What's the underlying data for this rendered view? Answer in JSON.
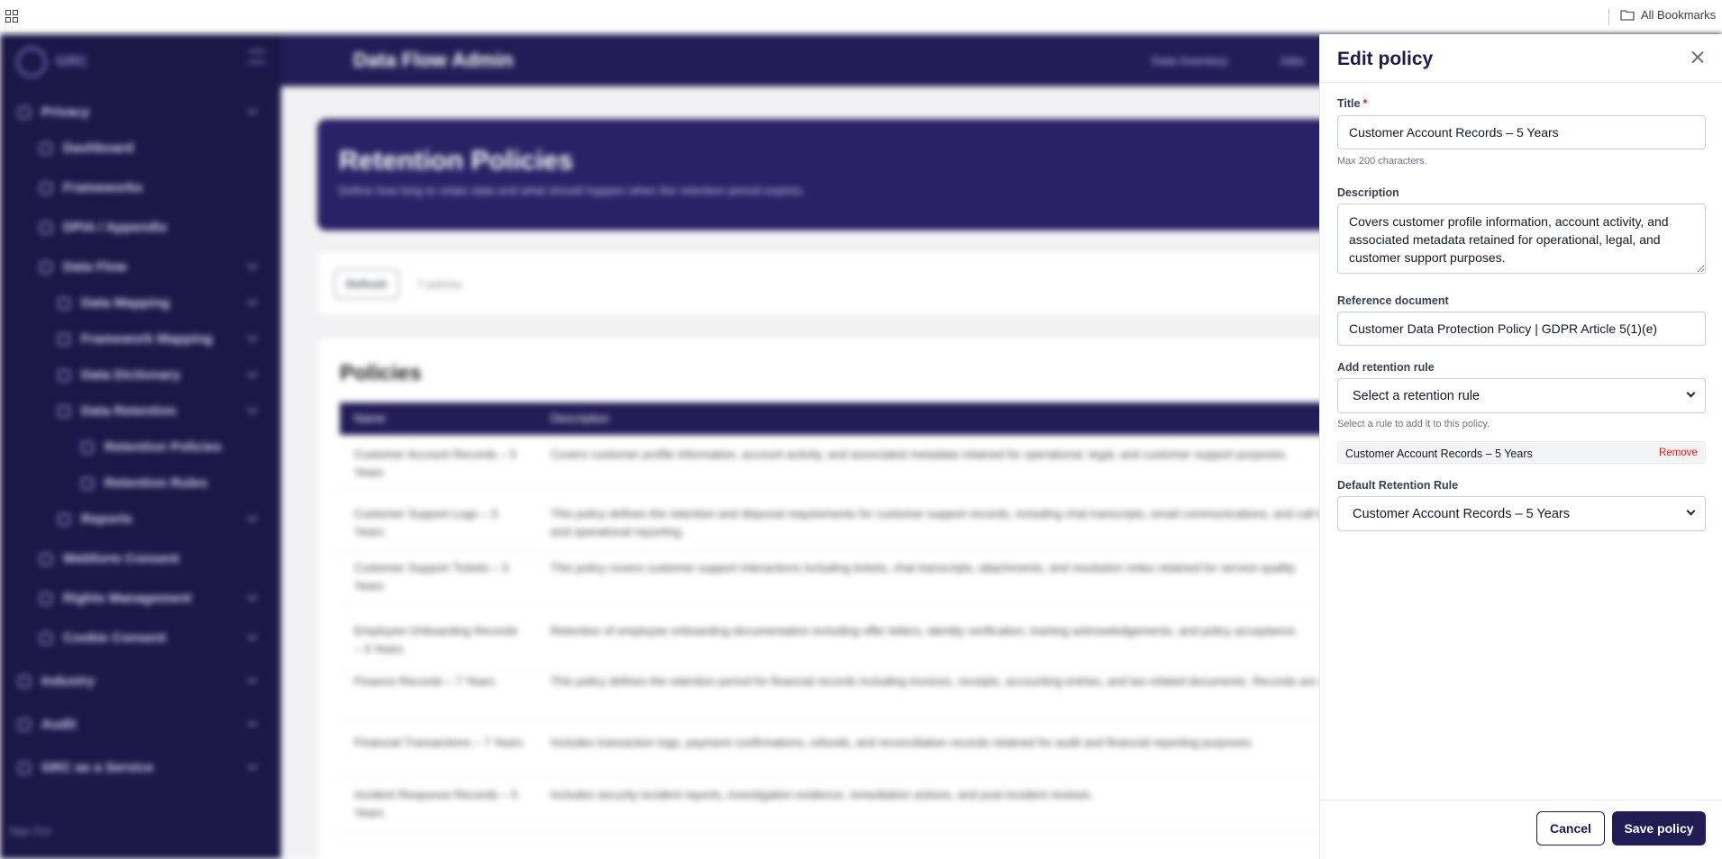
{
  "browser": {
    "bookmarks_label": "All Bookmarks"
  },
  "app": {
    "logo_text": "GRC",
    "header_title": "Data Flow Admin",
    "header_links": [
      "Data Inventory",
      "Jobs"
    ],
    "sidebar": {
      "items": [
        {
          "label": "Privacy",
          "level": 0
        },
        {
          "label": "Dashboard",
          "level": 1
        },
        {
          "label": "Frameworks",
          "level": 1
        },
        {
          "label": "DPIA / Appendix",
          "level": 1
        },
        {
          "label": "Data Flow",
          "level": 1
        },
        {
          "label": "Data Mapping",
          "level": 2
        },
        {
          "label": "Framework Mapping",
          "level": 2
        },
        {
          "label": "Data Dictionary",
          "level": 2
        },
        {
          "label": "Data Retention",
          "level": 2
        },
        {
          "label": "Retention Policies",
          "level": 3
        },
        {
          "label": "Retention Rules",
          "level": 3
        },
        {
          "label": "Reports",
          "level": 2
        },
        {
          "label": "Webform Consent",
          "level": 1
        },
        {
          "label": "Rights Management",
          "level": 1
        },
        {
          "label": "Cookie Consent",
          "level": 1
        },
        {
          "label": "Industry",
          "level": 0
        },
        {
          "label": "Audit",
          "level": 0
        },
        {
          "label": "GRC as a Service",
          "level": 0
        }
      ],
      "signout": "Sign Out"
    },
    "page": {
      "title": "Retention Policies",
      "subtitle": "Define how long to retain data and what should happen when the retention period expires.",
      "refresh_label": "Refresh",
      "count_label": "7 policies",
      "policies_heading": "Policies",
      "columns": [
        "Name",
        "Description"
      ],
      "rows": [
        {
          "name": "Customer Account Records – 5 Years",
          "description": "Covers customer profile information, account activity, and associated metadata retained for operational, legal, and customer support purposes."
        },
        {
          "name": "Customer Support Logs – 3 Years",
          "description": "This policy defines the retention and disposal requirements for customer support records, including chat transcripts, email communications, and call logs. These records are retained to support service quality, dispute resolution, and operational reporting."
        },
        {
          "name": "Customer Support Tickets – 3 Years",
          "description": "This policy covers customer support interactions including tickets, chat transcripts, attachments, and resolution notes retained for service quality."
        },
        {
          "name": "Employee Onboarding Records – 3 Years",
          "description": "Retention of employee onboarding documentation including offer letters, identity verification, training acknowledgements, and policy acceptance."
        },
        {
          "name": "Finance Records – 7 Years",
          "description": "This policy defines the retention period for financial records including invoices, receipts, accounting entries, and tax-related documents. Records are retained for audit, and regulatory compliance requirements."
        },
        {
          "name": "Financial Transactions – 7 Years",
          "description": "Includes transaction logs, payment confirmations, refunds, and reconciliation records retained for audit and financial reporting purposes."
        },
        {
          "name": "Incident Response Records – 5 Years",
          "description": "Includes security incident reports, investigation evidence, remediation actions, and post-incident reviews."
        }
      ]
    }
  },
  "drawer": {
    "title": "Edit policy",
    "title_field": {
      "label": "Title",
      "required_mark": "*",
      "value": "Customer Account Records – 5 Years",
      "help": "Max 200 characters."
    },
    "description_field": {
      "label": "Description",
      "value": "Covers customer profile information, account activity, and associated metadata retained for operational, legal, and customer support purposes."
    },
    "reference_field": {
      "label": "Reference document",
      "value": "Customer Data Protection Policy | GDPR Article 5(1)(e)"
    },
    "add_rule_field": {
      "label": "Add retention rule",
      "selected": "Select a retention rule",
      "help": "Select a rule to add it to this policy."
    },
    "added_rules": [
      {
        "name": "Customer Account Records – 5 Years",
        "remove_label": "Remove"
      }
    ],
    "default_rule_field": {
      "label": "Default Retention Rule",
      "selected": "Customer Account Records – 5 Years"
    },
    "footer": {
      "cancel_label": "Cancel",
      "save_label": "Save policy"
    }
  }
}
